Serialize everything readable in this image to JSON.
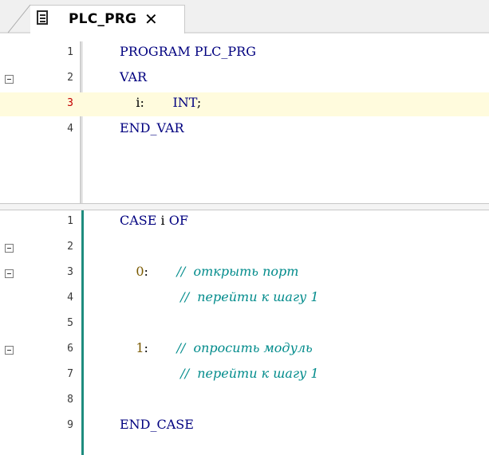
{
  "tab": {
    "title": "PLC_PRG",
    "close": "✕",
    "icon": "document-icon"
  },
  "declaration": {
    "lines": [
      {
        "num": "1",
        "fold": false,
        "current": false,
        "parts": [
          {
            "t": "PROGRAM PLC_PRG",
            "c": "kw"
          }
        ]
      },
      {
        "num": "2",
        "fold": true,
        "current": false,
        "parts": [
          {
            "t": "VAR",
            "c": "kw"
          }
        ]
      },
      {
        "num": "3",
        "fold": false,
        "current": true,
        "parts": [
          {
            "t": "    i:       ",
            "c": ""
          },
          {
            "t": "INT",
            "c": "kw"
          },
          {
            "t": ";",
            "c": ""
          }
        ]
      },
      {
        "num": "4",
        "fold": false,
        "current": false,
        "parts": [
          {
            "t": "END_VAR",
            "c": "kw"
          }
        ]
      }
    ]
  },
  "implementation": {
    "lines": [
      {
        "num": "1",
        "fold": false,
        "parts": [
          {
            "t": "CASE",
            "c": "kw"
          },
          {
            "t": " i ",
            "c": ""
          },
          {
            "t": "OF",
            "c": "kw"
          }
        ]
      },
      {
        "num": "2",
        "fold": true,
        "parts": []
      },
      {
        "num": "3",
        "fold": true,
        "parts": [
          {
            "t": "    ",
            "c": ""
          },
          {
            "t": "0",
            "c": "num"
          },
          {
            "t": ":       ",
            "c": ""
          },
          {
            "t": "//  открыть порт",
            "c": "cm"
          }
        ]
      },
      {
        "num": "4",
        "fold": false,
        "parts": [
          {
            "t": "               ",
            "c": ""
          },
          {
            "t": "//  перейти к шагу 1",
            "c": "cm"
          }
        ]
      },
      {
        "num": "5",
        "fold": false,
        "parts": []
      },
      {
        "num": "6",
        "fold": true,
        "parts": [
          {
            "t": "    ",
            "c": ""
          },
          {
            "t": "1",
            "c": "num"
          },
          {
            "t": ":       ",
            "c": ""
          },
          {
            "t": "//  опросить модуль",
            "c": "cm"
          }
        ]
      },
      {
        "num": "7",
        "fold": false,
        "parts": [
          {
            "t": "               ",
            "c": ""
          },
          {
            "t": "//  перейти к шагу 1",
            "c": "cm"
          }
        ]
      },
      {
        "num": "8",
        "fold": false,
        "parts": []
      },
      {
        "num": "9",
        "fold": false,
        "parts": [
          {
            "t": "END_CASE",
            "c": "kw"
          }
        ]
      }
    ]
  },
  "colors": {
    "keyword": "#00007f",
    "comment": "#008b8b",
    "number": "#7a5a00",
    "current_line": "#fffbdd",
    "changed_bar": "#1e8c7e"
  }
}
